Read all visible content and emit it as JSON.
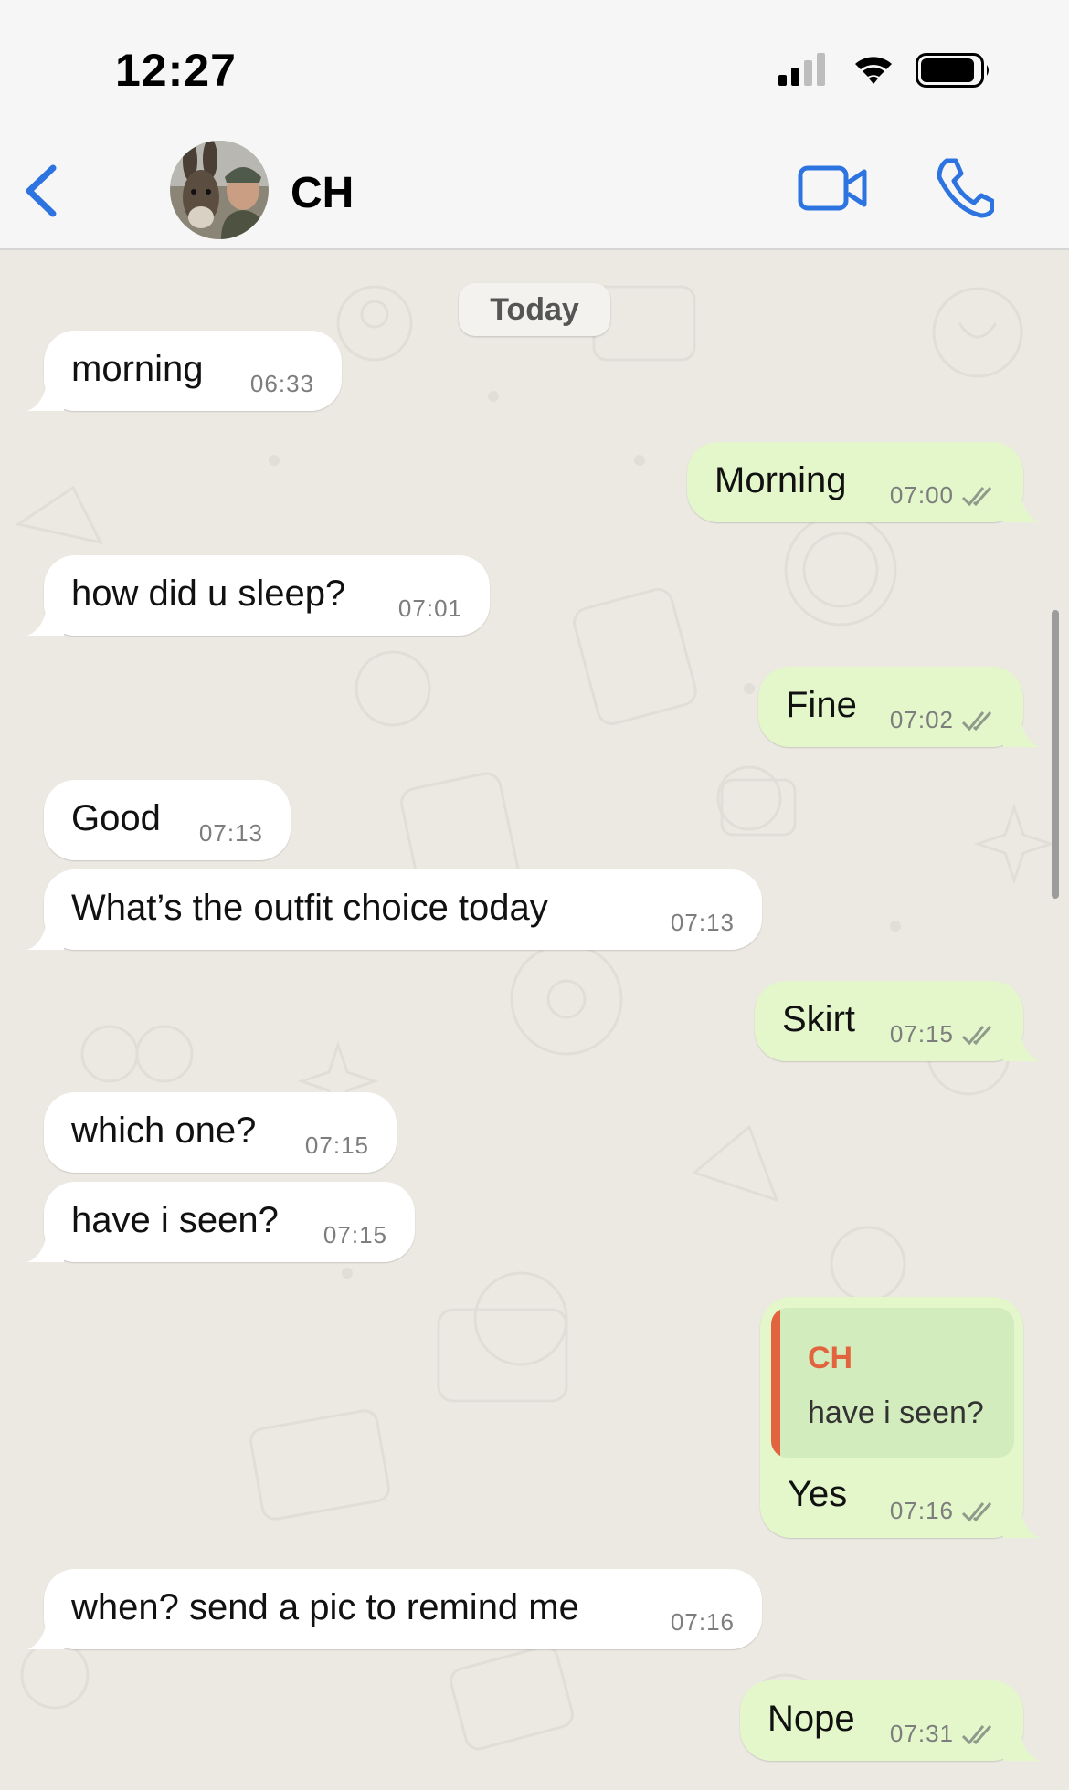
{
  "status": {
    "time": "12:27"
  },
  "contact": {
    "name": "CH"
  },
  "date_pill": "Today",
  "messages": [
    {
      "dir": "in",
      "text": "morning",
      "time": "06:33"
    },
    {
      "dir": "out",
      "text": "Morning",
      "time": "07:00"
    },
    {
      "dir": "in",
      "text": "how did u sleep?",
      "time": "07:01"
    },
    {
      "dir": "out",
      "text": "Fine",
      "time": "07:02"
    },
    {
      "dir": "in",
      "text": "Good",
      "time": "07:13"
    },
    {
      "dir": "in",
      "text": "What’s the outfit choice today",
      "time": "07:13"
    },
    {
      "dir": "out",
      "text": "Skirt",
      "time": "07:15"
    },
    {
      "dir": "in",
      "text": "which one?",
      "time": "07:15"
    },
    {
      "dir": "in",
      "text": "have i seen?",
      "time": "07:15"
    },
    {
      "dir": "out",
      "text": "Yes",
      "time": "07:16",
      "reply": {
        "name": "CH",
        "text": "have i seen?"
      }
    },
    {
      "dir": "in",
      "text": "when? send a pic to remind me",
      "time": "07:16"
    },
    {
      "dir": "out",
      "text": "Nope",
      "time": "07:31"
    }
  ],
  "colors": {
    "accent": "#2d74e0",
    "incoming_bubble": "#ffffff",
    "outgoing_bubble": "#e3f7cb",
    "quote_name": "#e2643f",
    "chat_background": "#ece9e3"
  },
  "icons": {
    "back": "chevron-left-icon",
    "video": "video-camera-icon",
    "call": "phone-icon",
    "read": "double-check-icon"
  }
}
